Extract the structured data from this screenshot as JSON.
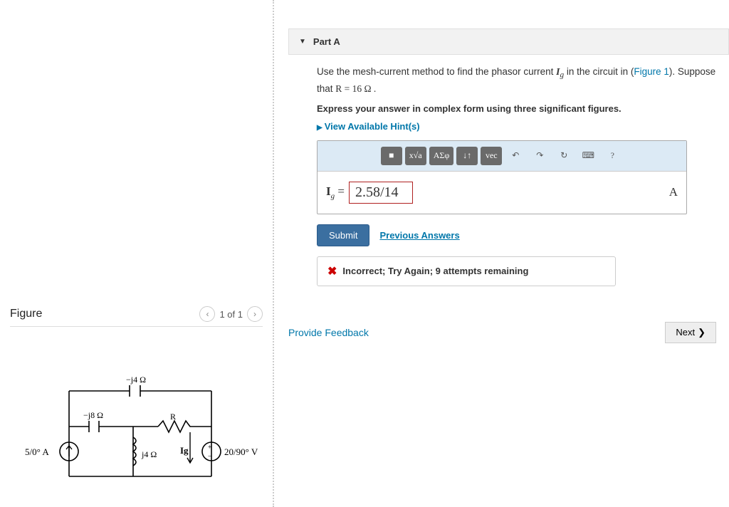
{
  "figure": {
    "title": "Figure",
    "pager": "1 of 1",
    "labels": {
      "top_cap": "−j4 Ω",
      "left_cap": "−j8 Ω",
      "resistor": "R",
      "inductor": "j4 Ω",
      "ig": "Ig",
      "src_left": "5/0° A",
      "src_right": "20/90° V"
    }
  },
  "part": {
    "title": "Part A",
    "prompt_pre": "Use the mesh-current method to find the phasor current ",
    "prompt_var": "Ig",
    "prompt_mid": " in the circuit in (",
    "figure_link": "Figure 1",
    "prompt_post": "). Suppose that ",
    "given": "R = 16 Ω .",
    "instruction": "Express your answer in complex form using three significant figures.",
    "hints_label": "View Available Hint(s)",
    "toolbar": {
      "t1": "■",
      "t2": "x√a",
      "t3": "ΑΣφ",
      "t4": "↓↑",
      "t5": "vec",
      "t6": "↶",
      "t7": "↷",
      "t8": "↻",
      "t9": "⌨",
      "t10": "?"
    },
    "answer_var": "Ig",
    "answer_value": "2.58/14",
    "answer_unit": "A",
    "submit": "Submit",
    "previous": "Previous Answers",
    "feedback": "Incorrect; Try Again; 9 attempts remaining"
  },
  "footer": {
    "provide": "Provide Feedback",
    "next": "Next"
  }
}
